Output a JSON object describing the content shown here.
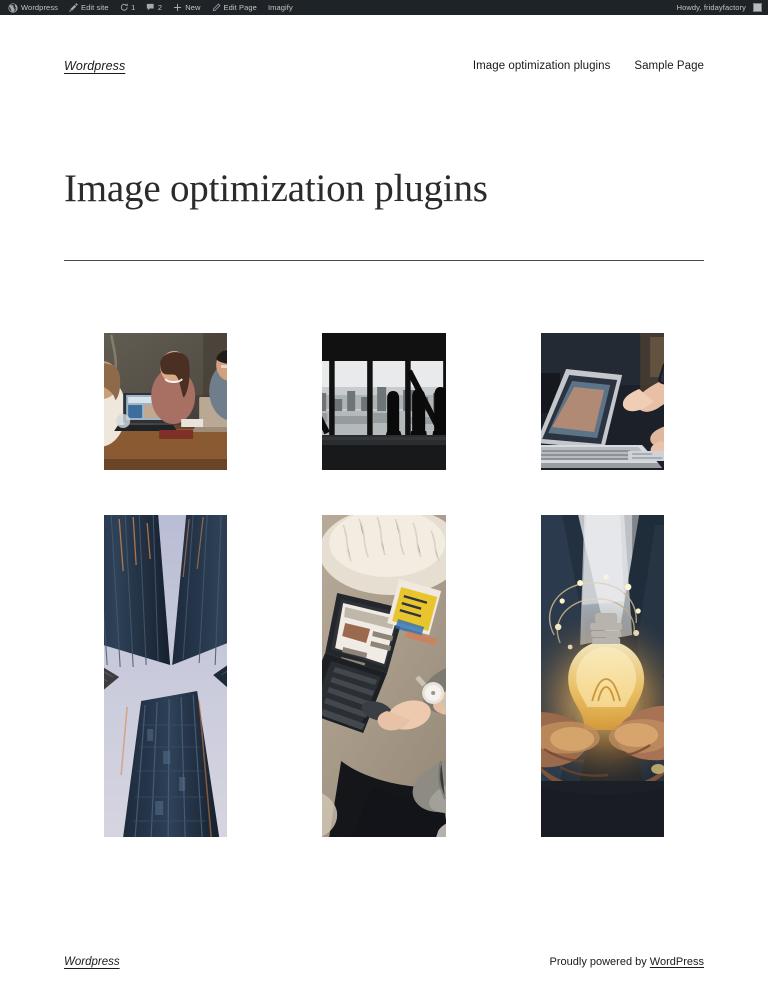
{
  "admin_bar": {
    "background": "#1d2327",
    "text_color": "#c3c4c7",
    "left_items": [
      {
        "icon": "wordpress-logo-icon",
        "label": "Wordpress"
      },
      {
        "icon": "customize-brush-icon",
        "label": "Edit site"
      },
      {
        "icon": "updates-icon",
        "label": "1"
      },
      {
        "icon": "comments-bubble-icon",
        "label": "2"
      },
      {
        "icon": "plus-icon",
        "label": "New"
      },
      {
        "icon": "pencil-icon",
        "label": "Edit Page"
      },
      {
        "icon": "imagify-icon",
        "label": "Imagify"
      }
    ],
    "account": {
      "greeting": "Howdy, fridayfactory",
      "avatar": "user-avatar"
    }
  },
  "header": {
    "site_title": "Wordpress",
    "nav": [
      {
        "label": "Image optimization plugins"
      },
      {
        "label": "Sample Page"
      }
    ]
  },
  "entry": {
    "title": "Image optimization plugins"
  },
  "gallery": {
    "rows": [
      {
        "orientation": "landscape",
        "items": [
          {
            "alt": "three-women-laptops-cafe"
          },
          {
            "alt": "blackwhite-office-window-city-skyline"
          },
          {
            "alt": "hand-pointing-at-laptop-screen"
          }
        ]
      },
      {
        "orientation": "portrait",
        "items": [
          {
            "alt": "skyscrapers-looking-up-x-shape"
          },
          {
            "alt": "person-on-laptop-on-fur-rug"
          },
          {
            "alt": "hands-holding-glowing-lightbulb"
          }
        ]
      }
    ]
  },
  "footer": {
    "site_title": "Wordpress",
    "credit_prefix": "Proudly powered by ",
    "credit_link": "WordPress"
  }
}
